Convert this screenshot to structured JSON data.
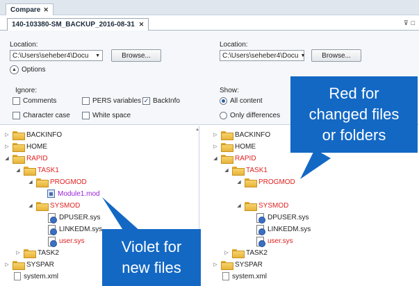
{
  "outer_tab": {
    "label": "Compare"
  },
  "doc_tab": {
    "label": "140-103380-SM_BACKUP_2016-08-31",
    "ctrls": [
      "⊽",
      "□"
    ]
  },
  "left": {
    "location_label": "Location:",
    "path": "C:\\Users\\seheber4\\Docu",
    "browse_label": "Browse...",
    "options_label": "Options",
    "ignore_label": "Ignore:",
    "checks": [
      {
        "label": "Comments",
        "checked": false
      },
      {
        "label": "PERS variables",
        "checked": false
      },
      {
        "label": "BackInfo",
        "checked": true
      },
      {
        "label": "Character case",
        "checked": false
      },
      {
        "label": "White space",
        "checked": false
      }
    ]
  },
  "right": {
    "location_label": "Location:",
    "path": "C:\\Users\\seheber4\\Docu",
    "browse_label": "Browse...",
    "show_label": "Show:",
    "radios": [
      {
        "label": "All content",
        "selected": true
      },
      {
        "label": "Only differences",
        "selected": false
      }
    ]
  },
  "left_tree": [
    {
      "label": "BACKINFO",
      "depth": 0,
      "expander": "▷",
      "icon": "folder",
      "color": "normal"
    },
    {
      "label": "HOME",
      "depth": 0,
      "expander": "▷",
      "icon": "folder",
      "color": "normal"
    },
    {
      "label": "RAPID",
      "depth": 0,
      "expander": "◢",
      "icon": "folder",
      "color": "red"
    },
    {
      "label": "TASK1",
      "depth": 1,
      "expander": "◢",
      "icon": "folder",
      "color": "red"
    },
    {
      "label": "PROGMOD",
      "depth": 2,
      "expander": "◢",
      "icon": "folder",
      "color": "red"
    },
    {
      "label": "Module1.mod",
      "depth": 3,
      "expander": "",
      "icon": "mod",
      "color": "violet"
    },
    {
      "label": "SYSMOD",
      "depth": 2,
      "expander": "◢",
      "icon": "folder",
      "color": "red"
    },
    {
      "label": "DPUSER.sys",
      "depth": 3,
      "expander": "",
      "icon": "sys",
      "color": "normal"
    },
    {
      "label": "LINKEDM.sys",
      "depth": 3,
      "expander": "",
      "icon": "sys",
      "color": "normal"
    },
    {
      "label": "user.sys",
      "depth": 3,
      "expander": "",
      "icon": "sys",
      "color": "red"
    },
    {
      "label": "TASK2",
      "depth": 1,
      "expander": "▷",
      "icon": "folder",
      "color": "normal"
    },
    {
      "label": "SYSPAR",
      "depth": 0,
      "expander": "▷",
      "icon": "folder",
      "color": "normal"
    },
    {
      "label": "system.xml",
      "depth": 0,
      "expander": "",
      "icon": "xml",
      "color": "normal"
    }
  ],
  "right_tree": [
    {
      "label": "BACKINFO",
      "depth": 0,
      "expander": "▷",
      "icon": "folder",
      "color": "normal"
    },
    {
      "label": "HOME",
      "depth": 0,
      "expander": "▷",
      "icon": "folder",
      "color": "normal"
    },
    {
      "label": "RAPID",
      "depth": 0,
      "expander": "◢",
      "icon": "folder",
      "color": "red"
    },
    {
      "label": "TASK1",
      "depth": 1,
      "expander": "◢",
      "icon": "folder",
      "color": "red"
    },
    {
      "label": "PROGMOD",
      "depth": 2,
      "expander": "◢",
      "icon": "folder",
      "color": "red"
    },
    {
      "label": "",
      "depth": 3,
      "expander": "",
      "icon": "blank",
      "color": "normal"
    },
    {
      "label": "SYSMOD",
      "depth": 2,
      "expander": "◢",
      "icon": "folder",
      "color": "red"
    },
    {
      "label": "DPUSER.sys",
      "depth": 3,
      "expander": "",
      "icon": "sys",
      "color": "normal"
    },
    {
      "label": "LINKEDM.sys",
      "depth": 3,
      "expander": "",
      "icon": "sys",
      "color": "normal"
    },
    {
      "label": "user.sys",
      "depth": 3,
      "expander": "",
      "icon": "sys",
      "color": "red"
    },
    {
      "label": "TASK2",
      "depth": 1,
      "expander": "▷",
      "icon": "folder",
      "color": "normal"
    },
    {
      "label": "SYSPAR",
      "depth": 0,
      "expander": "▷",
      "icon": "folder",
      "color": "normal"
    },
    {
      "label": "system.xml",
      "depth": 0,
      "expander": "",
      "icon": "xml",
      "color": "normal"
    }
  ],
  "callouts": {
    "red": {
      "lines": [
        "Red for",
        "changed files",
        "or folders"
      ]
    },
    "violet": {
      "lines": [
        "Violet for",
        "new files"
      ]
    }
  },
  "colors": {
    "changed": "#e02020",
    "new": "#9a1fd6",
    "callout": "#1368c4"
  }
}
